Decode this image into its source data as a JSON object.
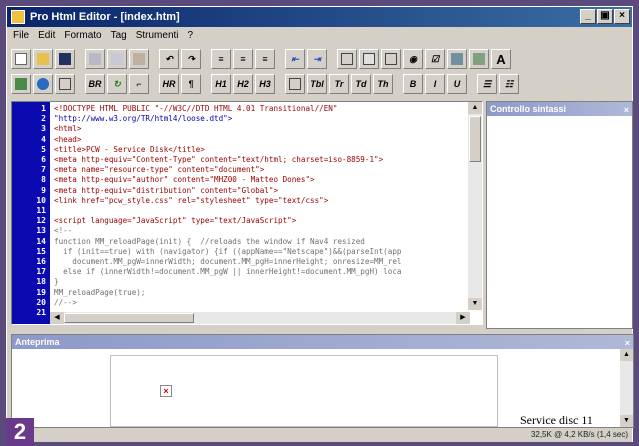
{
  "window": {
    "title": "Pro Html Editor - [index.htm]",
    "min": "_",
    "max": "▣",
    "close": "×"
  },
  "menu": [
    "File",
    "Edit",
    "Formato",
    "Tag",
    "Strumenti",
    "?"
  ],
  "toolbar2": {
    "br": "BR",
    "hr": "HR",
    "para": "¶",
    "h1": "H1",
    "h2": "H2",
    "h3": "H3",
    "tbl": "Tbl",
    "tr": "Tr",
    "td": "Td",
    "th": "Th",
    "b": "B",
    "i": "I",
    "u": "U"
  },
  "editor": {
    "lines": [
      "1",
      "2",
      "3",
      "4",
      "5",
      "6",
      "7",
      "8",
      "9",
      "10",
      "11",
      "12",
      "13",
      "14",
      "15",
      "16",
      "17",
      "18",
      "19",
      "20",
      "21"
    ],
    "code": [
      "<!DOCTYPE HTML PUBLIC \"-//W3C//DTD HTML 4.01 Transitional//EN\"",
      "\"http://www.w3.org/TR/html4/loose.dtd\">",
      "<html>",
      "<head>",
      "<title>PCW - Service Disk</title>",
      "<meta http-equiv=\"Content-Type\" content=\"text/html; charset=iso-8859-1\">",
      "<meta name=\"resource-type\" content=\"document\">",
      "<meta http-equiv=\"author\" content=\"MHZ00 - Matteo Dones\">",
      "<meta http-equiv=\"distribution\" content=\"Global\">",
      "<link href=\"pcw_style.css\" rel=\"stylesheet\" type=\"text/css\">",
      "",
      "<script language=\"JavaScript\" type=\"text/JavaScript\">",
      "<!--",
      "function MM_reloadPage(init) {  //reloads the window if Nav4 resized",
      "  if (init==true) with (navigator) {if ((appName==\"Netscape\")&&(parseInt(app",
      "    document.MM_pgW=innerWidth; document.MM_pgH=innerHeight; onresize=MM_rel",
      "  else if (innerWidth!=document.MM_pgW || innerHeight!=document.MM_pgH) loca",
      "}",
      "MM_reloadPage(true);",
      "//-->",
      ""
    ]
  },
  "syntax_panel": {
    "title": "Controllo sintassi",
    "close": "×"
  },
  "preview": {
    "title": "Anteprima",
    "close": "×",
    "text": "Service disc 11"
  },
  "status": {
    "info": "32,5K @ 4,2 KB/s (1,4 sec)"
  },
  "badge": "2"
}
